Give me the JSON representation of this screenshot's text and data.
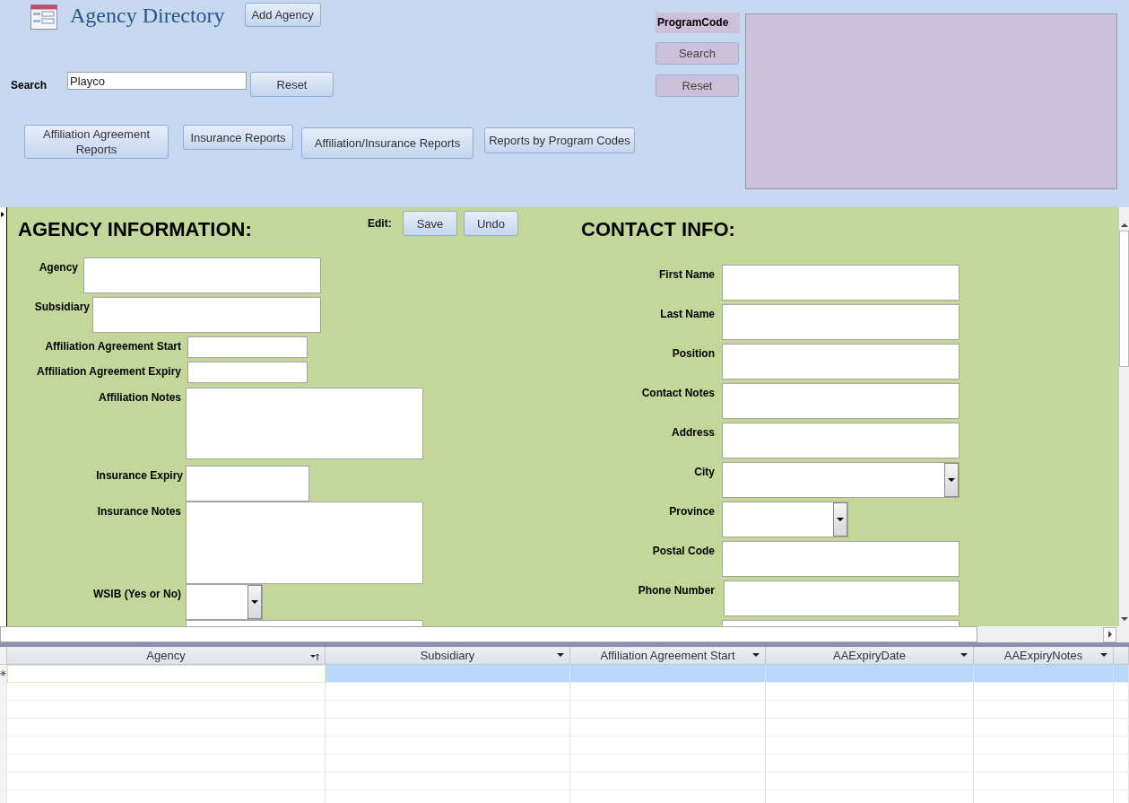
{
  "header": {
    "title": "Agency Directory",
    "add_button": "Add Agency",
    "search": {
      "label": "Search",
      "value": "Playco"
    },
    "reset_button": "Reset",
    "report_buttons": [
      "Affiliation Agreement Reports",
      "Insurance Reports",
      "Affiliation/Insurance Reports",
      "Reports by Program Codes"
    ],
    "program_code": {
      "label": "ProgramCode",
      "search_button": "Search",
      "reset_button": "Reset"
    }
  },
  "form": {
    "heading": "AGENCY INFORMATION:",
    "edit_label": "Edit:",
    "save_button": "Save",
    "undo_button": "Undo",
    "contact_heading": "CONTACT INFO:",
    "agency_fields": [
      {
        "label": "Agency",
        "kind": "text"
      },
      {
        "label": "Subsidiary",
        "kind": "text"
      },
      {
        "label": "Affiliation Agreement Start",
        "kind": "text"
      },
      {
        "label": "Affiliation Agreement Expiry",
        "kind": "text"
      },
      {
        "label": "Affiliation Notes",
        "kind": "text"
      },
      {
        "label": "Insurance Expiry",
        "kind": "text"
      },
      {
        "label": "Insurance Notes",
        "kind": "text"
      },
      {
        "label": "WSIB (Yes or No)",
        "kind": "combo"
      },
      {
        "kind": "text"
      }
    ],
    "contact_fields": [
      {
        "label": "First Name",
        "kind": "text"
      },
      {
        "label": "Last Name",
        "kind": "text"
      },
      {
        "label": "Position",
        "kind": "text"
      },
      {
        "label": "Contact Notes",
        "kind": "text"
      },
      {
        "label": "Address",
        "kind": "text"
      },
      {
        "label": "City",
        "kind": "combo"
      },
      {
        "label": "Province",
        "kind": "combo"
      },
      {
        "label": "Postal Code",
        "kind": "text"
      },
      {
        "label": "Phone Number",
        "kind": "text"
      },
      {
        "kind": "text"
      }
    ]
  },
  "datasheet": {
    "columns": [
      {
        "label": "Agency",
        "sorted": true
      },
      {
        "label": "Subsidiary",
        "sorted": false
      },
      {
        "label": "Affiliation Agreement Start",
        "sorted": false
      },
      {
        "label": "AAExpiryDate",
        "sorted": false
      },
      {
        "label": "AAExpiryNotes",
        "sorted": false
      }
    ],
    "rows": [
      {
        "new_record": true,
        "selected": true
      }
    ]
  }
}
